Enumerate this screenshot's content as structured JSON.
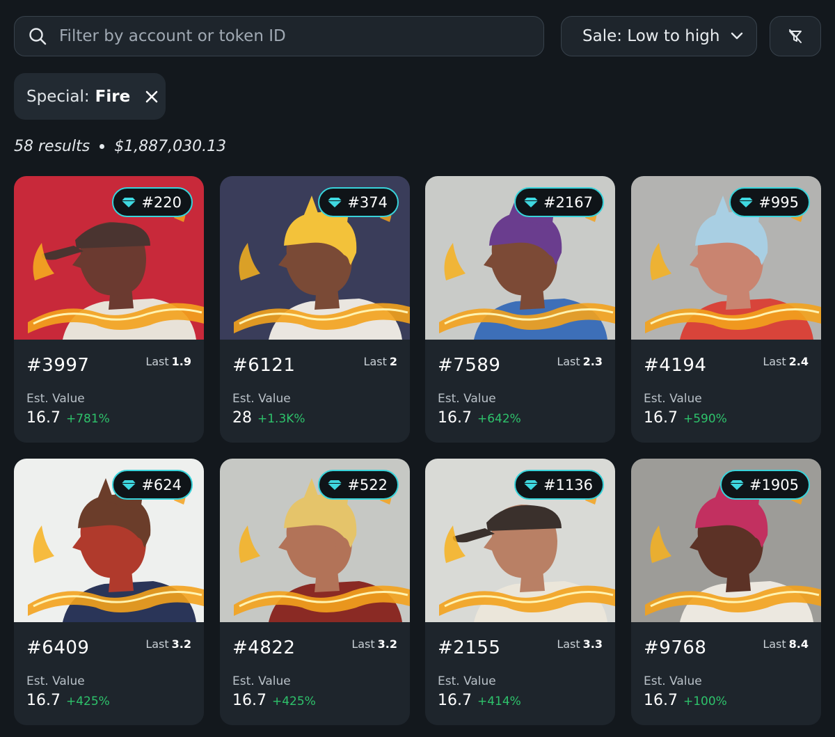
{
  "search": {
    "placeholder": "Filter by account or token ID",
    "icon": "search-icon"
  },
  "sort": {
    "label": "Sale: Low to high",
    "icon": "chevron-down-icon"
  },
  "filter_clear": {
    "icon": "filter-off-icon"
  },
  "active_filter": {
    "key": "Special:",
    "value": "Fire",
    "icon": "close-icon"
  },
  "summary": {
    "results": "58 results",
    "total": "$1,887,030.13"
  },
  "colors": {
    "accent_badge": "#38d3da",
    "positive": "#2ec26b",
    "background": "#13181d",
    "card": "#1e252c"
  },
  "cards": [
    {
      "rank": "#220",
      "token": "#3997",
      "last_label": "Last",
      "last": "1.9",
      "est_label": "Est. Value",
      "est": "16.7",
      "change": "+781%",
      "bg": "#c8293a",
      "skin": "#6b3a30",
      "hair": "#2a1f1d",
      "shirt": "#e8e2d8",
      "hat": true,
      "hatColor": "#4a3430"
    },
    {
      "rank": "#374",
      "token": "#6121",
      "last_label": "Last",
      "last": "2",
      "est_label": "Est. Value",
      "est": "28",
      "change": "+1.3K%",
      "bg": "#3a3d5a",
      "skin": "#7a4a36",
      "hair": "#f3c23a",
      "shirt": "#eae6e0",
      "hat": false,
      "hatColor": ""
    },
    {
      "rank": "#2167",
      "token": "#7589",
      "last_label": "Last",
      "last": "2.3",
      "est_label": "Est. Value",
      "est": "16.7",
      "change": "+642%",
      "bg": "#c9cbc8",
      "skin": "#7c4a36",
      "hair": "#6a3d8e",
      "shirt": "#3d6fb8",
      "hat": false,
      "hatColor": ""
    },
    {
      "rank": "#995",
      "token": "#4194",
      "last_label": "Last",
      "last": "2.4",
      "est_label": "Est. Value",
      "est": "16.7",
      "change": "+590%",
      "bg": "#b3b3b1",
      "skin": "#c98470",
      "hair": "#a9cfe3",
      "shirt": "#d8443a",
      "hat": false,
      "hatColor": ""
    },
    {
      "rank": "#624",
      "token": "#6409",
      "last_label": "Last",
      "last": "3.2",
      "est_label": "Est. Value",
      "est": "16.7",
      "change": "+425%",
      "bg": "#eef0ee",
      "skin": "#b03a2c",
      "hair": "#6b3d2a",
      "shirt": "#2a3558",
      "hat": false,
      "hatColor": ""
    },
    {
      "rank": "#522",
      "token": "#4822",
      "last_label": "Last",
      "last": "3.2",
      "est_label": "Est. Value",
      "est": "16.7",
      "change": "+425%",
      "bg": "#c6c8c4",
      "skin": "#b27358",
      "hair": "#e5c46a",
      "shirt": "#8a2a24",
      "hat": false,
      "hatColor": ""
    },
    {
      "rank": "#1136",
      "token": "#2155",
      "last_label": "Last",
      "last": "3.3",
      "est_label": "Est. Value",
      "est": "16.7",
      "change": "+414%",
      "bg": "#d9dad6",
      "skin": "#b98065",
      "hair": "#1d2b30",
      "shirt": "#ebe6da",
      "hat": true,
      "hatColor": "#3a302c"
    },
    {
      "rank": "#1905",
      "token": "#9768",
      "last_label": "Last",
      "last": "8.4",
      "est_label": "Est. Value",
      "est": "16.7",
      "change": "+100%",
      "bg": "#9d9c98",
      "skin": "#5c3226",
      "hair": "#c23060",
      "shirt": "#ece8e0",
      "hat": false,
      "hatColor": ""
    }
  ]
}
